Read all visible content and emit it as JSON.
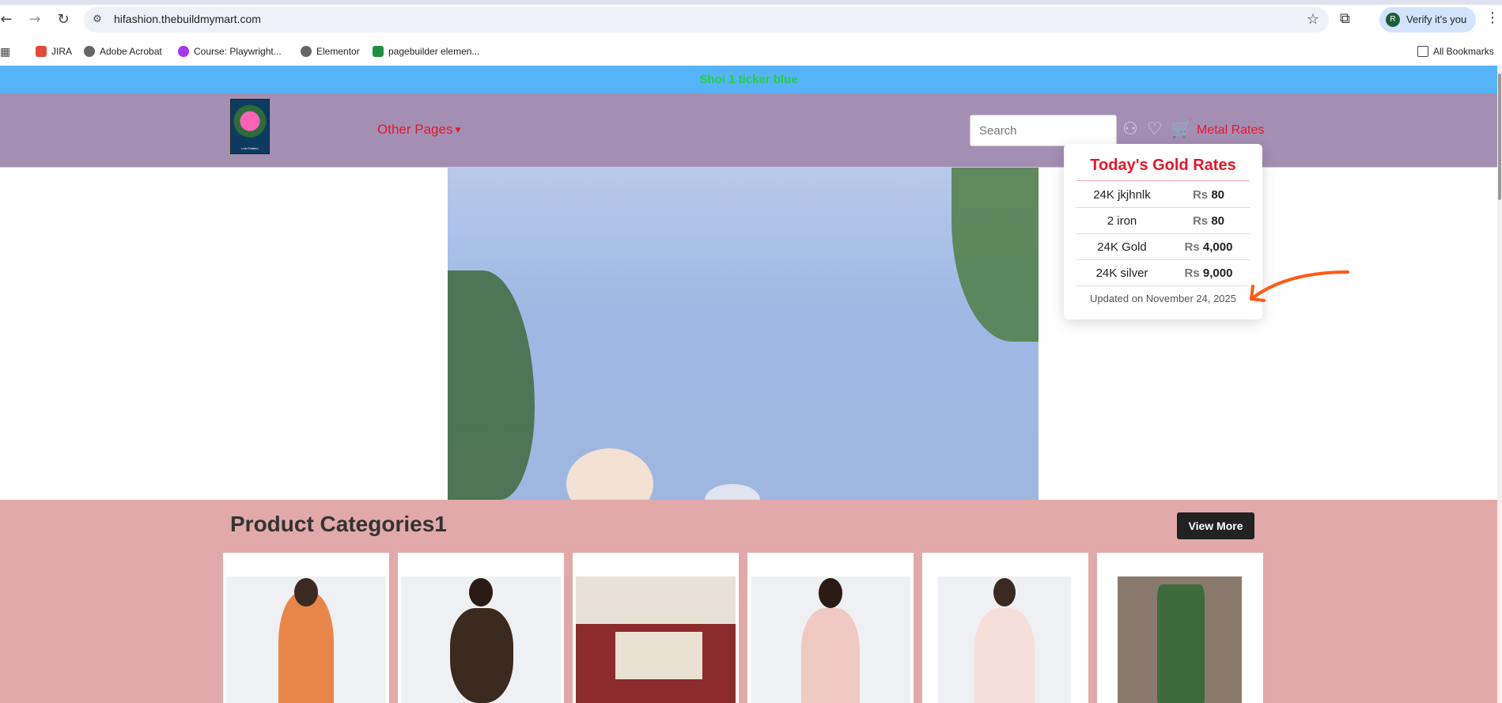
{
  "browser": {
    "url": "hifashion.thebuildmymart.com",
    "verify_label": "Verify it's you",
    "avatar_letter": "R",
    "bookmarks": [
      {
        "label": "JIRA",
        "color": "#e04b3c"
      },
      {
        "label": "Adobe Acrobat",
        "color": "#666666"
      },
      {
        "label": "Course: Playwright...",
        "color": "#a435f0"
      },
      {
        "label": "Elementor",
        "color": "#666666"
      },
      {
        "label": "pagebuilder elemen...",
        "color": "#1e8e3e"
      }
    ],
    "all_bookmarks": "All Bookmarks"
  },
  "ticker": {
    "text": "Shoi 1 ticker blue"
  },
  "header": {
    "logo_caption": "Lost Pattern",
    "nav_other_pages": "Other Pages",
    "search_placeholder": "Search",
    "metal_rates_label": "Metal Rates"
  },
  "rates_popup": {
    "title": "Today's Gold Rates",
    "rows": [
      {
        "name": "24K jkjhnlk",
        "currency": "Rs",
        "price": "80"
      },
      {
        "name": "2 iron",
        "currency": "Rs",
        "price": "80"
      },
      {
        "name": "24K Gold",
        "currency": "Rs",
        "price": "4,000"
      },
      {
        "name": "24K silver",
        "currency": "Rs",
        "price": "9,000"
      }
    ],
    "updated": "Updated on November 24, 2025"
  },
  "categories": {
    "title": "Product Categories1",
    "view_more": "View More"
  },
  "colors": {
    "ticker_bg": "#56b3f7",
    "header_bg": "#a48fb4",
    "accent_red": "#e4172a",
    "categories_bg": "#e2a9ab",
    "annotation_orange": "#ff5a14"
  }
}
